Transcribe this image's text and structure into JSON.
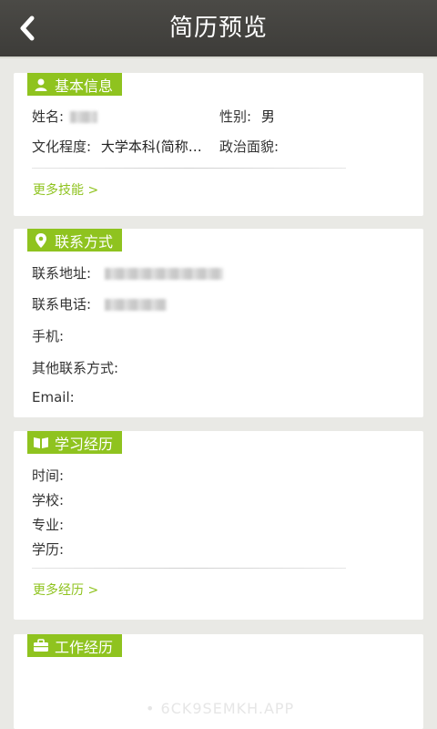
{
  "header": {
    "title": "简历预览"
  },
  "basic_info": {
    "section_label": "基本信息",
    "name_label": "姓名:",
    "gender_label": "性别:",
    "gender_value": "男",
    "education_label": "文化程度:",
    "education_value": "大学本科(简称…",
    "political_label": "政治面貌:",
    "more_label": "更多技能 >"
  },
  "contact": {
    "section_label": "联系方式",
    "address_label": "联系地址:",
    "phone_label": "联系电话:",
    "mobile_label": "手机:",
    "other_label": "其他联系方式:",
    "email_label": "Email:"
  },
  "study": {
    "section_label": "学习经历",
    "time_label": "时间:",
    "school_label": "学校:",
    "major_label": "专业:",
    "degree_label": "学历:",
    "more_label": "更多经历 >"
  },
  "work": {
    "section_label": "工作经历"
  },
  "watermark": "• 6CK9SEMKH.APP",
  "colors": {
    "accent": "#8fc31f",
    "topbar": "#43423e",
    "background": "#e9e9e5"
  }
}
